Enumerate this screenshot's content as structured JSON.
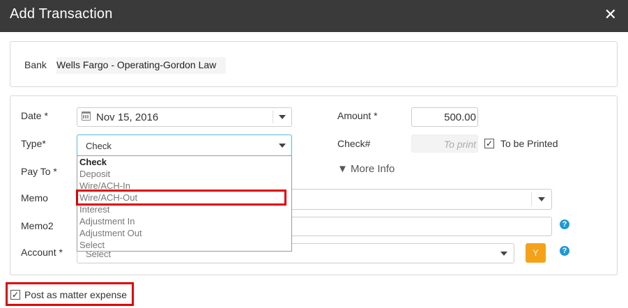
{
  "dialog": {
    "title": "Add Transaction",
    "close_glyph": "✕"
  },
  "bank": {
    "label": "Bank",
    "value": "Wells Fargo - Operating-Gordon Law"
  },
  "form": {
    "date_label": "Date *",
    "date_value": "Nov 15, 2016",
    "amount_label": "Amount *",
    "amount_value": "500.00",
    "type_label": "Type*",
    "type_value": "Check",
    "type_options": [
      "Check",
      "Deposit",
      "Wire/ACH-In",
      "Wire/ACH-Out",
      "Interest",
      "Adjustment In",
      "Adjustment Out",
      "Select"
    ],
    "type_selected": "Check",
    "check_label": "Check#",
    "check_placeholder": "To print",
    "to_be_printed_label": "To be Printed",
    "to_be_printed_checked": true,
    "payto_label": "Pay To *",
    "more_info_label": "▼ More Info",
    "memo_label": "Memo",
    "memo2_label": "Memo2",
    "account_label": "Account *",
    "account_placeholder": "Select",
    "y_button_label": "Y",
    "help_glyph": "?"
  },
  "footer": {
    "post_expense_label": "Post as matter expense",
    "post_expense_checked": true
  },
  "colors": {
    "titlebar": "#3a3a3a",
    "highlight": "#e00000",
    "accent_button": "#f5a21a",
    "help_icon": "#1b9ad6"
  },
  "icons": [
    "close-icon",
    "calendar-icon",
    "chevron-down-icon",
    "help-icon",
    "checkmark-icon"
  ]
}
